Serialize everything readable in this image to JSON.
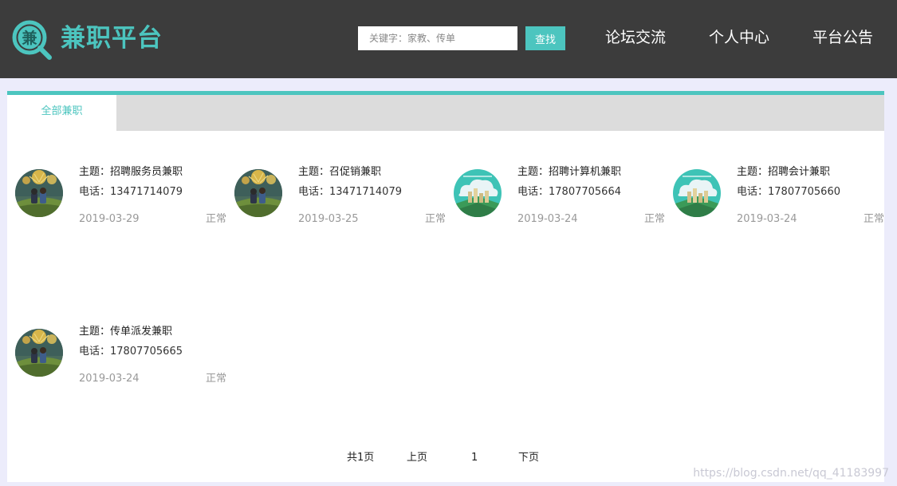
{
  "header": {
    "logo_char": "兼",
    "logo_text": "兼职平台",
    "search": {
      "placeholder": "关键字：家教、传单",
      "button_label": "查找"
    },
    "nav": [
      "论坛交流",
      "个人中心",
      "平台公告"
    ]
  },
  "tabs": {
    "active": "全部兼职"
  },
  "jobs": [
    {
      "title": "主题：招聘服务员兼职",
      "phone": "电话：13471714079",
      "date": "2019-03-29",
      "status": "正常",
      "avatar": "kids-fireworks-icon"
    },
    {
      "title": "主题：召促销兼职",
      "phone": "电话：13471714079",
      "date": "2019-03-25",
      "status": "正常",
      "avatar": "kids-fireworks-icon"
    },
    {
      "title": "主题：招聘计算机兼职",
      "phone": "电话：17807705664",
      "date": "2019-03-24",
      "status": "正常",
      "avatar": "city-cloud-icon"
    },
    {
      "title": "主题：招聘会计兼职",
      "phone": "电话：17807705660",
      "date": "2019-03-24",
      "status": "正常",
      "avatar": "city-cloud-icon"
    },
    {
      "title": "主题：传单派发兼职",
      "phone": "电话：17807705665",
      "date": "2019-03-24",
      "status": "正常",
      "avatar": "kids-fireworks-icon"
    }
  ],
  "pagination": {
    "total": "共1页",
    "prev": "上页",
    "current": "1",
    "next": "下页"
  },
  "watermark": "https://blog.csdn.net/qq_41183997",
  "colors": {
    "accent": "#4cc5bf",
    "header_bg": "#3c3c3c",
    "page_bg": "#ececfb",
    "tab_bar_bg": "#dcdcdc"
  }
}
